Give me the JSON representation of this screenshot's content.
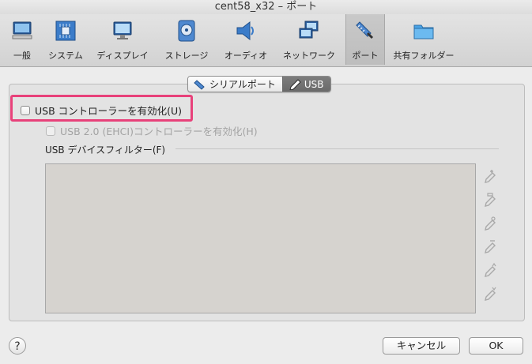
{
  "window": {
    "title": "cent58_x32 – ポート"
  },
  "toolbar": {
    "items": [
      {
        "label": "一般",
        "icon": "monitor-general-icon"
      },
      {
        "label": "システム",
        "icon": "chip-icon"
      },
      {
        "label": "ディスプレイ",
        "icon": "display-icon"
      },
      {
        "label": "ストレージ",
        "icon": "disk-icon"
      },
      {
        "label": "オーディオ",
        "icon": "speaker-icon"
      },
      {
        "label": "ネットワーク",
        "icon": "network-icon"
      },
      {
        "label": "ポート",
        "icon": "port-plug-icon",
        "selected": true
      },
      {
        "label": "共有フォルダー",
        "icon": "folder-icon"
      }
    ]
  },
  "tabs": {
    "serial": "シリアルポート",
    "usb": "USB",
    "active": "USB"
  },
  "usb": {
    "enable_controller": {
      "label": "USB コントローラーを有効化(U)",
      "checked": false
    },
    "enable_ehci": {
      "label": "USB 2.0 (EHCI)コントローラーを有効化(H)",
      "checked": false,
      "disabled": true
    },
    "filters_label": "USB デバイスフィルター(F)",
    "filters": [],
    "side_actions": [
      "add-filter-icon",
      "add-from-device-icon",
      "edit-filter-icon",
      "remove-filter-icon",
      "move-up-icon",
      "move-down-icon"
    ]
  },
  "footer": {
    "help": "?",
    "cancel": "キャンセル",
    "ok": "OK"
  },
  "colors": {
    "highlight": "#e8417a"
  }
}
